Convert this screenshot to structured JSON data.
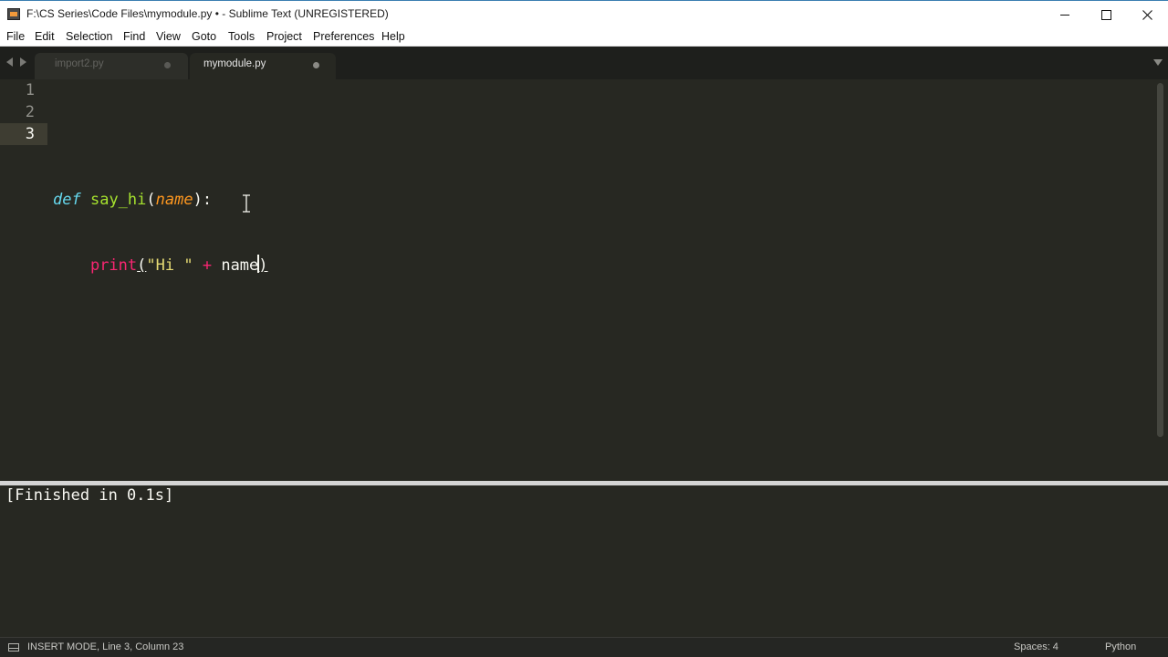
{
  "window": {
    "title": "F:\\CS Series\\Code Files\\mymodule.py • - Sublime Text (UNREGISTERED)",
    "title_bar_color": "#ffffff"
  },
  "menu": {
    "items": [
      {
        "label": "File"
      },
      {
        "label": "Edit"
      },
      {
        "label": "Selection"
      },
      {
        "label": "Find"
      },
      {
        "label": "View"
      },
      {
        "label": "Goto"
      },
      {
        "label": "Tools"
      },
      {
        "label": "Project"
      },
      {
        "label": "Preferences"
      },
      {
        "label": "Help"
      }
    ]
  },
  "tabs": [
    {
      "label": "import2.py",
      "modified": true,
      "active": false
    },
    {
      "label": "mymodule.py",
      "modified": true,
      "active": true
    }
  ],
  "editor": {
    "line_numbers": [
      "1",
      "2",
      "3"
    ],
    "current_line": 3,
    "code": {
      "line2": {
        "keyword": "def",
        "function_name": "say_hi",
        "open_paren": "(",
        "param": "name",
        "close": "):"
      },
      "line3": {
        "indent": "    ",
        "builtin": "print",
        "open_paren": "(",
        "string": "\"Hi \"",
        "operator": "+",
        "identifier": "name",
        "close_paren": ")"
      }
    },
    "theme_colors": {
      "background": "#272822",
      "keyword": "#66d9ef",
      "function": "#a6e22e",
      "parameter": "#fd971f",
      "builtin": "#f92672",
      "string": "#e6db74"
    }
  },
  "output": {
    "text": "[Finished in 0.1s]"
  },
  "status": {
    "left": "INSERT MODE, Line 3, Column 23",
    "spaces": "Spaces: 4",
    "syntax": "Python"
  }
}
